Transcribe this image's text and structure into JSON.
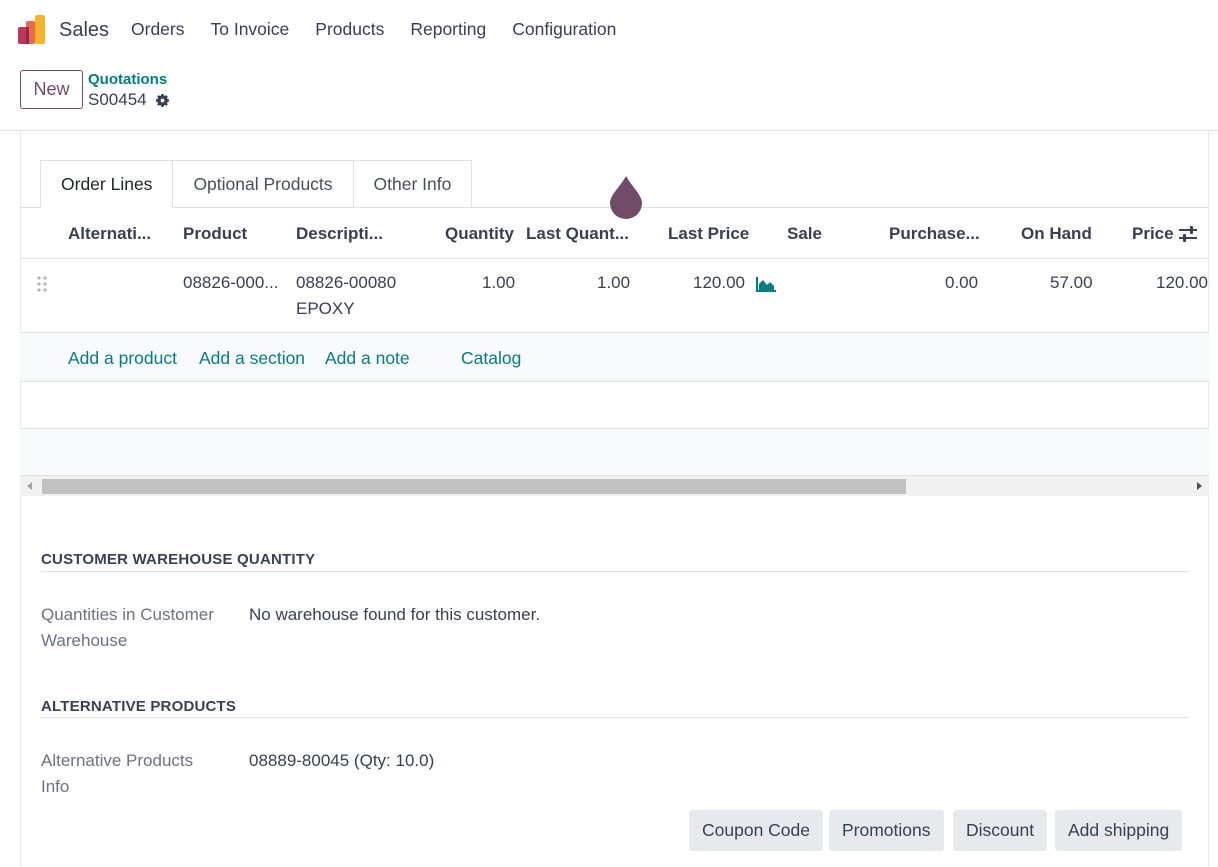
{
  "nav": {
    "app_name": "Sales",
    "menu": [
      "Orders",
      "To Invoice",
      "Products",
      "Reporting",
      "Configuration"
    ]
  },
  "control_panel": {
    "new_label": "New",
    "breadcrumb": "Quotations",
    "record": "S00454"
  },
  "tabs": [
    "Order Lines",
    "Optional Products",
    "Other Info"
  ],
  "table": {
    "headers": [
      "Alternati...",
      "Product",
      "Descripti...",
      "Quantity",
      "Last Quant...",
      "Last Price",
      "Sale",
      "Purchase...",
      "On Hand",
      "Price"
    ],
    "row": {
      "alternative": "",
      "product": "08826-000...",
      "description_line1": "08826-00080",
      "description_line2": "EPOXY",
      "quantity": "1.00",
      "last_quantity": "1.00",
      "last_price": "120.00",
      "purchase": "0.00",
      "on_hand": "57.00",
      "price": "120.00"
    },
    "add_links": [
      "Add a product",
      "Add a section",
      "Add a note",
      "Catalog"
    ]
  },
  "customer_warehouse": {
    "title": "CUSTOMER WAREHOUSE QUANTITY",
    "label_line1": "Quantities in Customer",
    "label_line2": "Warehouse",
    "value": "No warehouse found for this customer."
  },
  "alternative_products": {
    "title": "ALTERNATIVE PRODUCTS",
    "label_line1": "Alternative Products",
    "label_line2": "Info",
    "value": "08889-80045 (Qty: 10.0)"
  },
  "buttons": [
    "Coupon Code",
    "Promotions",
    "Discount",
    "Add shipping"
  ],
  "colors": {
    "brand": "#714b67",
    "link": "#017e84"
  }
}
